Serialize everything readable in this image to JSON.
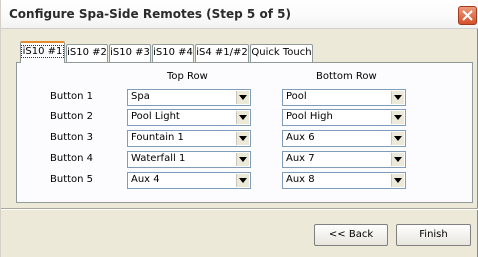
{
  "window": {
    "title": "Configure Spa-Side Remotes (Step 5 of 5)",
    "close_icon": "close-icon",
    "close_color": "#d5512b"
  },
  "tabs": [
    {
      "label": "iS10 #1",
      "active": true
    },
    {
      "label": "iS10 #2",
      "active": false
    },
    {
      "label": "iS10 #3",
      "active": false
    },
    {
      "label": "iS10 #4",
      "active": false
    },
    {
      "label": "iS4 #1/#2",
      "active": false
    },
    {
      "label": "Quick Touch",
      "active": false
    }
  ],
  "grid": {
    "top_row_header": "Top Row",
    "bottom_row_header": "Bottom Row",
    "rows": [
      {
        "label": "Button 1",
        "top": "Spa",
        "bottom": "Pool"
      },
      {
        "label": "Button 2",
        "top": "Pool Light",
        "bottom": "Pool High"
      },
      {
        "label": "Button 3",
        "top": "Fountain 1",
        "bottom": "Aux 6"
      },
      {
        "label": "Button 4",
        "top": "Waterfall 1",
        "bottom": "Aux 7"
      },
      {
        "label": "Button 5",
        "top": "Aux 4",
        "bottom": "Aux 8"
      }
    ]
  },
  "footer": {
    "back_label": "<< Back",
    "finish_label": "Finish"
  }
}
